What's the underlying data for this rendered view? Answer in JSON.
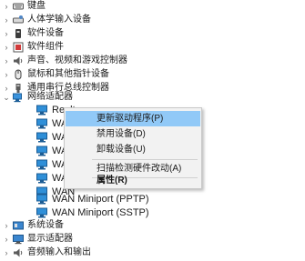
{
  "tree": {
    "categories_top": [
      {
        "label": "键盘",
        "icon": "keyboard-icon"
      },
      {
        "label": "人体学输入设备",
        "icon": "hid-icon"
      },
      {
        "label": "软件设备",
        "icon": "software-device-icon"
      },
      {
        "label": "软件组件",
        "icon": "software-component-icon"
      },
      {
        "label": "声音、视频和游戏控制器",
        "icon": "speaker-icon"
      },
      {
        "label": "鼠标和其他指针设备",
        "icon": "mouse-icon"
      },
      {
        "label": "通用串行总线控制器",
        "icon": "usb-icon"
      }
    ],
    "network": {
      "label": "网络适配器",
      "icon": "network-adapter-icon",
      "children": [
        {
          "label": "Realte"
        },
        {
          "label": "WAN"
        },
        {
          "label": "WAN"
        },
        {
          "label": "WAN"
        },
        {
          "label": "WAN"
        },
        {
          "label": "WAN"
        },
        {
          "label": "WAN"
        },
        {
          "label": "WAN Miniport (PPTP)"
        },
        {
          "label": "WAN Miniport (SSTP)"
        }
      ]
    },
    "categories_bottom": [
      {
        "label": "系统设备",
        "icon": "system-device-icon"
      },
      {
        "label": "显示适配器",
        "icon": "display-adapter-icon"
      },
      {
        "label": "音频输入和输出",
        "icon": "audio-io-icon"
      }
    ]
  },
  "context_menu": {
    "update_driver": "更新驱动程序(P)",
    "disable_device": "禁用设备(D)",
    "uninstall_device": "卸载设备(U)",
    "scan_hardware": "扫描检测硬件改动(A)",
    "properties": "属性(R)"
  },
  "colors": {
    "highlight": "#91c9f7",
    "menu_bg": "#f2f2f2",
    "adapter_icon": "#2f8fd8"
  }
}
